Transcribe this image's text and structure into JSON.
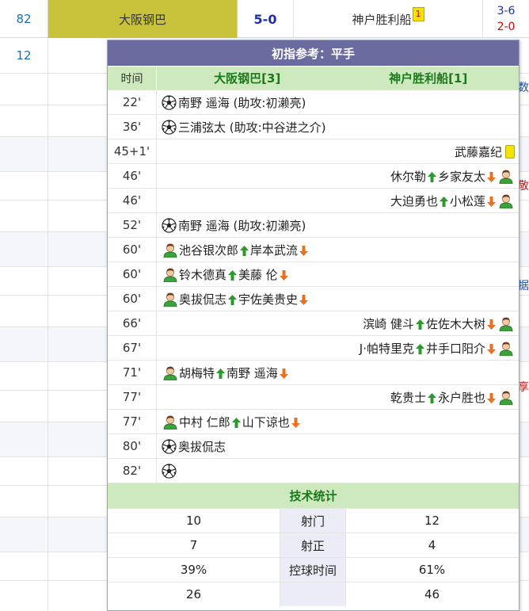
{
  "match_row": {
    "minute": "82",
    "home": "大阪钢巴",
    "score": "5-0",
    "away": "神户胜利船",
    "away_yellow_badge": "1",
    "ht_line1": "3-6",
    "ht_line2": "2-0",
    "colors": {
      "home_highlight": "#c8c23a",
      "score": "#1d2fa6",
      "ht_red": "#e00000"
    }
  },
  "next_row": {
    "minute": "12"
  },
  "edge_texts": [
    "指数",
    "不敬",
    "数据",
    "享"
  ],
  "popup": {
    "title": "初指参考：平手",
    "header": {
      "time": "时间",
      "home": "大阪钢巴[3]",
      "away": "神户胜利船[1]"
    },
    "events": [
      {
        "time": "22'",
        "side": "home",
        "type": "goal",
        "text": "南野 遥海 (助攻:初濑亮)"
      },
      {
        "time": "36'",
        "side": "home",
        "type": "goal",
        "text": "三浦弦太 (助攻:中谷进之介)"
      },
      {
        "time": "45+1'",
        "side": "away",
        "type": "yellow",
        "text": "武藤嘉纪"
      },
      {
        "time": "46'",
        "side": "away",
        "type": "sub",
        "in": "休尔勒",
        "out": "乡家友太"
      },
      {
        "time": "46'",
        "side": "away",
        "type": "sub",
        "in": "大迫勇也",
        "out": "小松莲"
      },
      {
        "time": "52'",
        "side": "home",
        "type": "goal",
        "text": "南野 遥海 (助攻:初濑亮)"
      },
      {
        "time": "60'",
        "side": "home",
        "type": "sub",
        "in": "池谷银次郎",
        "out": "岸本武流"
      },
      {
        "time": "60'",
        "side": "home",
        "type": "sub",
        "in": "铃木德真",
        "out": "美藤 伦"
      },
      {
        "time": "60'",
        "side": "home",
        "type": "sub",
        "in": "奥拔侃志",
        "out": "宇佐美贵史"
      },
      {
        "time": "66'",
        "side": "away",
        "type": "sub",
        "in": "滨崎 健斗",
        "out": "佐佐木大树"
      },
      {
        "time": "67'",
        "side": "away",
        "type": "sub",
        "in": "J·帕特里克",
        "out": "井手口阳介"
      },
      {
        "time": "71'",
        "side": "home",
        "type": "sub",
        "in": "胡梅特",
        "out": "南野 遥海"
      },
      {
        "time": "77'",
        "side": "away",
        "type": "sub",
        "in": "乾贵士",
        "out": "永户胜也"
      },
      {
        "time": "77'",
        "side": "home",
        "type": "sub",
        "in": "中村 仁郎",
        "out": "山下谅也"
      },
      {
        "time": "80'",
        "side": "home",
        "type": "goal",
        "text": "奥拔侃志"
      },
      {
        "time": "82'",
        "side": "home",
        "type": "goal",
        "text": ""
      }
    ],
    "stats_title": "技术统计",
    "stats": [
      {
        "home": "10",
        "label": "射门",
        "away": "12"
      },
      {
        "home": "7",
        "label": "射正",
        "away": "4"
      },
      {
        "home": "39%",
        "label": "控球时间",
        "away": "61%"
      },
      {
        "home": "26",
        "label": "",
        "away": "46"
      }
    ],
    "colors": {
      "title_bg": "#6b6b9f",
      "header_bg": "#cfe9bf",
      "team_green": "#1a7a1a",
      "sub_in": "#2a9a2a",
      "sub_out": "#e8701e"
    }
  }
}
